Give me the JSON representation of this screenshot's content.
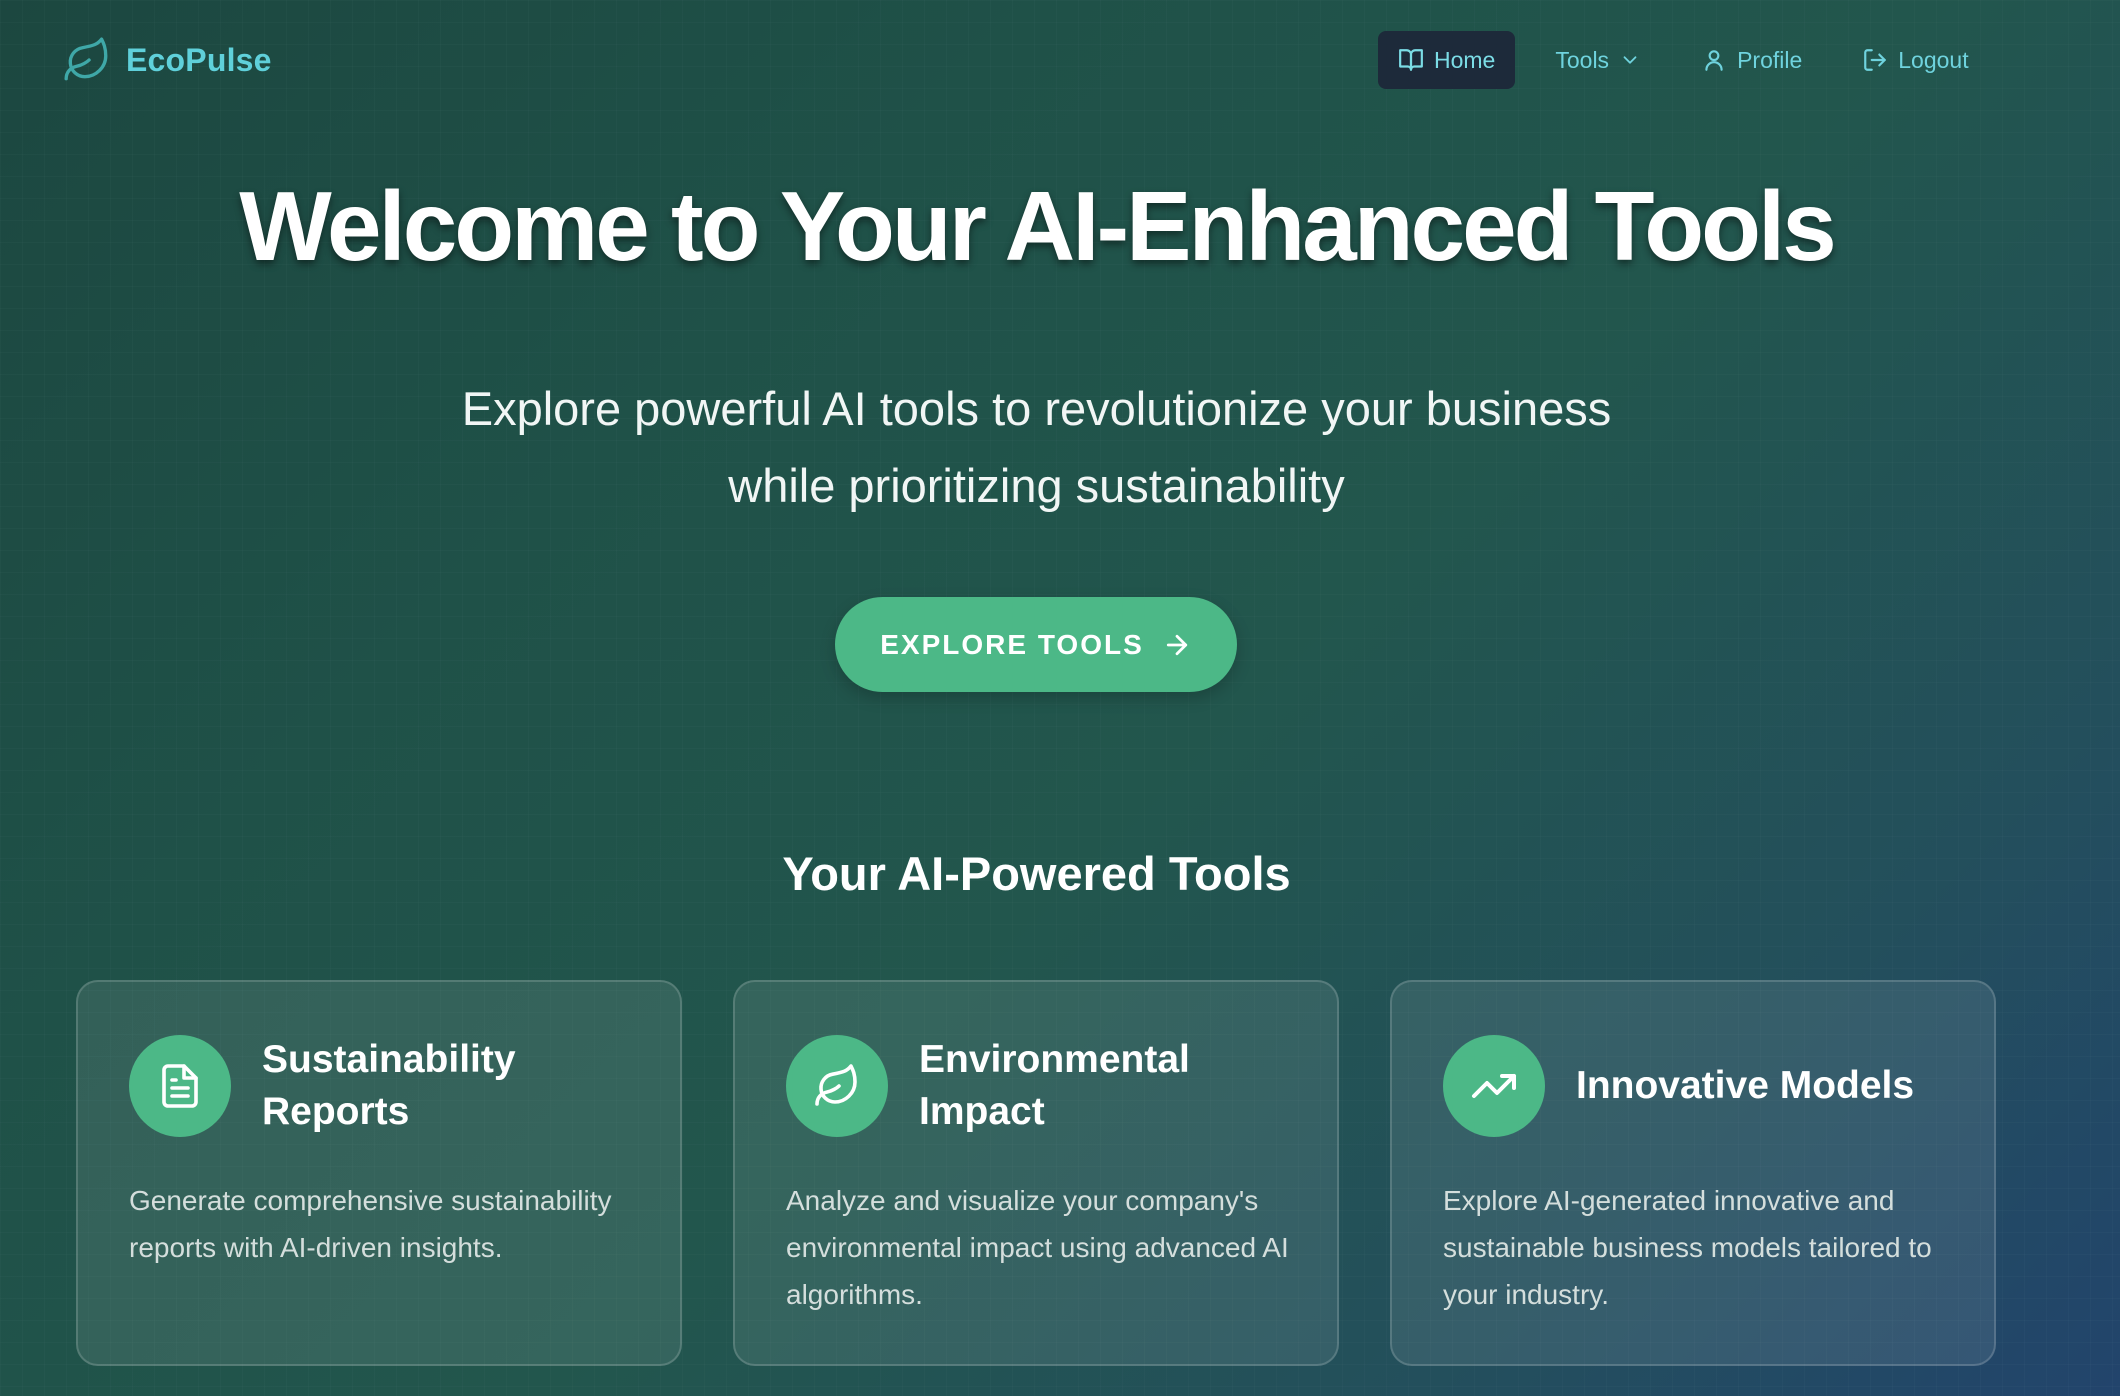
{
  "header": {
    "logo_text": "EcoPulse",
    "nav": {
      "home": "Home",
      "tools": "Tools",
      "profile": "Profile",
      "logout": "Logout"
    }
  },
  "hero": {
    "title": "Welcome to Your AI-Enhanced Tools",
    "subtitle_line1": "Explore powerful AI tools to revolutionize your business",
    "subtitle_line2": "while prioritizing sustainability",
    "cta_label": "EXPLORE TOOLS"
  },
  "tools_section": {
    "title": "Your AI-Powered Tools",
    "cards": [
      {
        "title_line1": "Sustainability",
        "title_line2": "Reports",
        "description": "Generate comprehensive sustainability reports with AI-driven insights.",
        "icon": "document-icon"
      },
      {
        "title_line1": "Environmental",
        "title_line2": "Impact",
        "description": "Analyze and visualize your company's environmental impact using advanced AI algorithms.",
        "icon": "leaf-icon"
      },
      {
        "title_line1": "Innovative Models",
        "title_line2": "",
        "description": "Explore AI-generated innovative and sustainable business models tailored to your industry.",
        "icon": "trending-up-icon"
      }
    ]
  },
  "colors": {
    "accent": "#4cb887",
    "logo": "#5fd0da",
    "nav_link": "#6fd3de",
    "nav_active_bg": "#1d2a3a"
  }
}
